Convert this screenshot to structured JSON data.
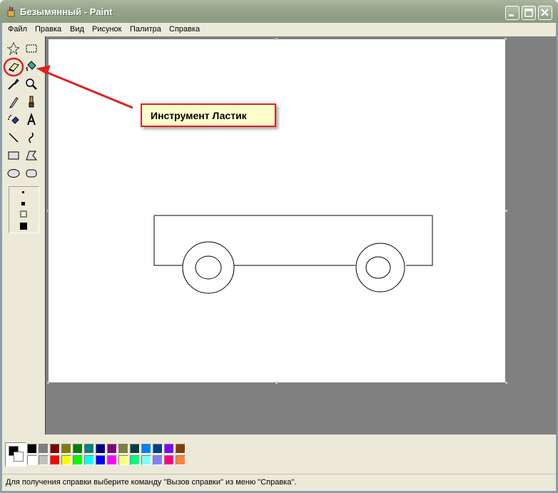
{
  "window": {
    "title": "Безымянный - Paint",
    "controls": [
      "minimize",
      "maximize",
      "close"
    ]
  },
  "menu": {
    "items": [
      "Файл",
      "Правка",
      "Вид",
      "Рисунок",
      "Палитра",
      "Справка"
    ]
  },
  "toolbox": {
    "tools": [
      {
        "name": "free-select-icon"
      },
      {
        "name": "rect-select-icon"
      },
      {
        "name": "eraser-icon",
        "highlighted": true
      },
      {
        "name": "fill-icon"
      },
      {
        "name": "color-picker-icon"
      },
      {
        "name": "magnifier-icon"
      },
      {
        "name": "pencil-icon"
      },
      {
        "name": "brush-icon"
      },
      {
        "name": "airbrush-icon"
      },
      {
        "name": "text-icon",
        "glyph": "A"
      },
      {
        "name": "line-icon"
      },
      {
        "name": "curve-icon"
      },
      {
        "name": "rectangle-icon"
      },
      {
        "name": "polygon-icon"
      },
      {
        "name": "ellipse-icon"
      },
      {
        "name": "rounded-rect-icon"
      }
    ]
  },
  "palette": {
    "foreground": "#000000",
    "background": "#ffffff",
    "top_row": [
      "#000000",
      "#808080",
      "#800000",
      "#808000",
      "#008000",
      "#008080",
      "#000080",
      "#800080",
      "#808040",
      "#004040",
      "#0080ff",
      "#004080",
      "#8000ff",
      "#804000"
    ],
    "bottom_row": [
      "#ffffff",
      "#c0c0c0",
      "#ff0000",
      "#ffff00",
      "#00ff00",
      "#00ffff",
      "#0000ff",
      "#ff00ff",
      "#ffff80",
      "#00ff80",
      "#80ffff",
      "#8080ff",
      "#ff0080",
      "#ff8040"
    ]
  },
  "status": {
    "text": "Для получения справки выберите команду \"Вызов справки\" из меню \"Справка\"."
  },
  "annotation": {
    "label": "Инструмент Ластик",
    "color": "#e02020"
  }
}
